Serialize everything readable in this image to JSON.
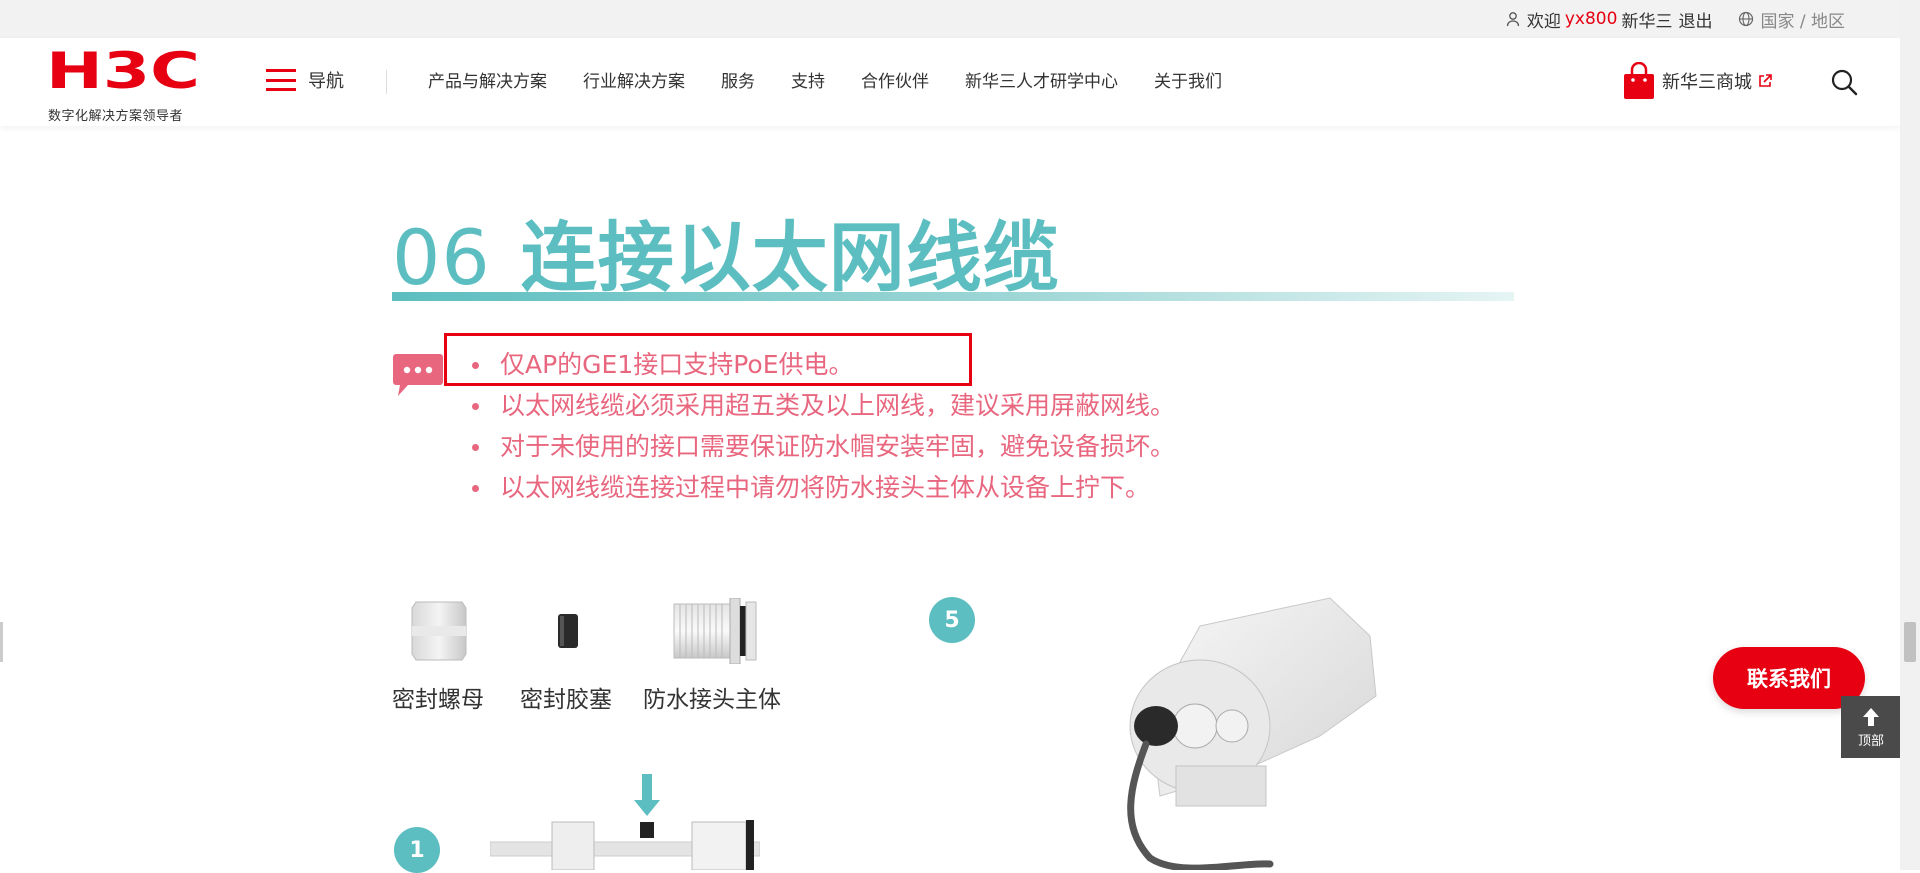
{
  "utility": {
    "welcome": "欢迎",
    "username": "yx800",
    "company": "新华三",
    "logout": "退出",
    "region": "国家 / 地区"
  },
  "header": {
    "logo_text": "H3C",
    "logo_tagline": "数字化解决方案领导者",
    "nav_label": "导航",
    "menu": [
      "产品与解决方案",
      "行业解决方案",
      "服务",
      "支持",
      "合作伙伴",
      "新华三人才研学中心",
      "关于我们"
    ],
    "shop_label": "新华三商城"
  },
  "section": {
    "number": "06",
    "title": "连接以太网线缆",
    "notes": [
      "仅AP的GE1接口支持PoE供电。",
      "以太网线缆必须采用超五类及以上网线，建议采用屏蔽网线。",
      "对于未使用的接口需要保证防水帽安装牢固，避免设备损坏。",
      "以太网线缆连接过程中请勿将防水接头主体从设备上拧下。"
    ]
  },
  "parts": [
    {
      "label": "密封螺母"
    },
    {
      "label": "密封胶塞"
    },
    {
      "label": "防水接头主体"
    }
  ],
  "steps": {
    "step_a": "5",
    "step_b": "1"
  },
  "floating": {
    "contact": "联系我们",
    "top": "顶部"
  },
  "colors": {
    "brand_red": "#e60012",
    "teal": "#5cbec0",
    "note_pink": "#e8677f"
  }
}
